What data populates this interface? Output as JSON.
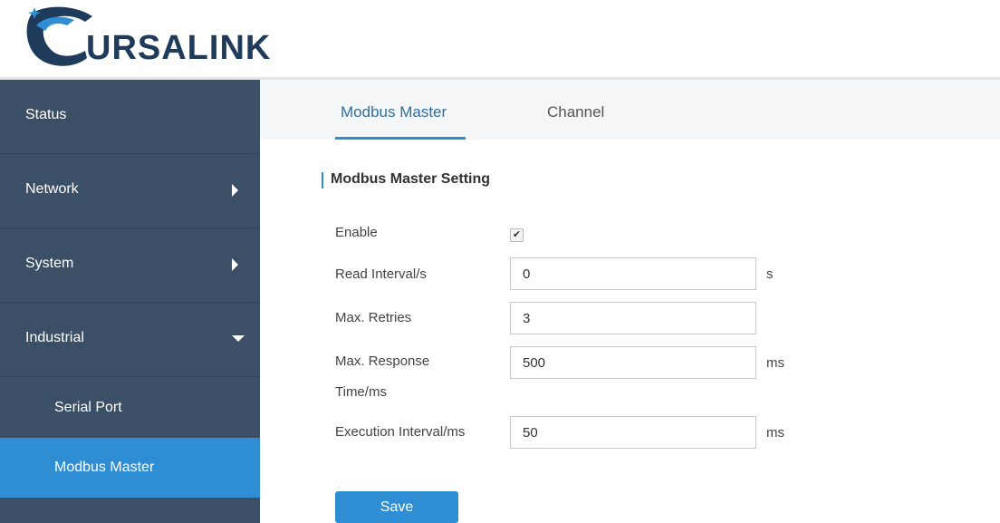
{
  "header": {
    "logo_text": "URSALINK"
  },
  "sidebar": {
    "items": [
      {
        "label": "Status"
      },
      {
        "label": "Network"
      },
      {
        "label": "System"
      },
      {
        "label": "Industrial"
      }
    ],
    "subitems": [
      {
        "label": "Serial Port"
      },
      {
        "label": "Modbus Master",
        "active": true
      }
    ]
  },
  "tabs": [
    {
      "label": "Modbus Master",
      "active": true
    },
    {
      "label": "Channel"
    }
  ],
  "section": {
    "title": "Modbus Master Setting"
  },
  "form": {
    "enable": {
      "label": "Enable",
      "checked": true
    },
    "read_interval": {
      "label": "Read Interval/s",
      "value": "0",
      "unit": "s"
    },
    "max_retries": {
      "label": "Max. Retries",
      "value": "3"
    },
    "max_response_time": {
      "label_line1": "Max. Response",
      "label_line2": "Time/ms",
      "value": "500",
      "unit": "ms"
    },
    "execution_interval": {
      "label": "Execution Interval/ms",
      "value": "50",
      "unit": "ms"
    }
  },
  "actions": {
    "save_label": "Save"
  },
  "colors": {
    "sidebar_bg": "#3b4f66",
    "accent": "#2f8ed3",
    "logo_dark": "#1f3b5c"
  }
}
